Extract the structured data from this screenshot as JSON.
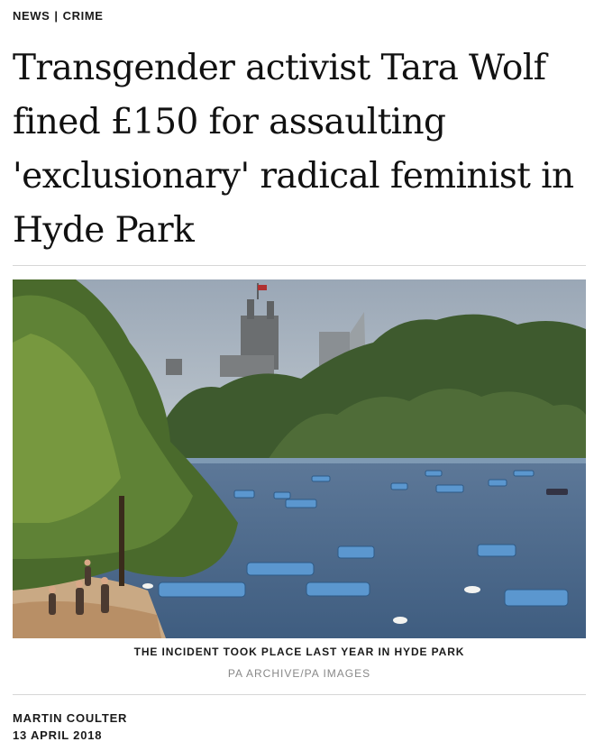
{
  "breadcrumb": {
    "section": "NEWS",
    "separator": "|",
    "category": "CRIME"
  },
  "headline": "Transgender activist Tara Wolf fined £150 for assaulting 'exclusionary' radical feminist in Hyde Park",
  "image": {
    "caption": "THE INCIDENT TOOK PLACE LAST YEAR IN HYDE PARK",
    "credit": "PA ARCHIVE/PA IMAGES"
  },
  "byline": {
    "author": "MARTIN COULTER",
    "date": "13 APRIL 2018"
  }
}
